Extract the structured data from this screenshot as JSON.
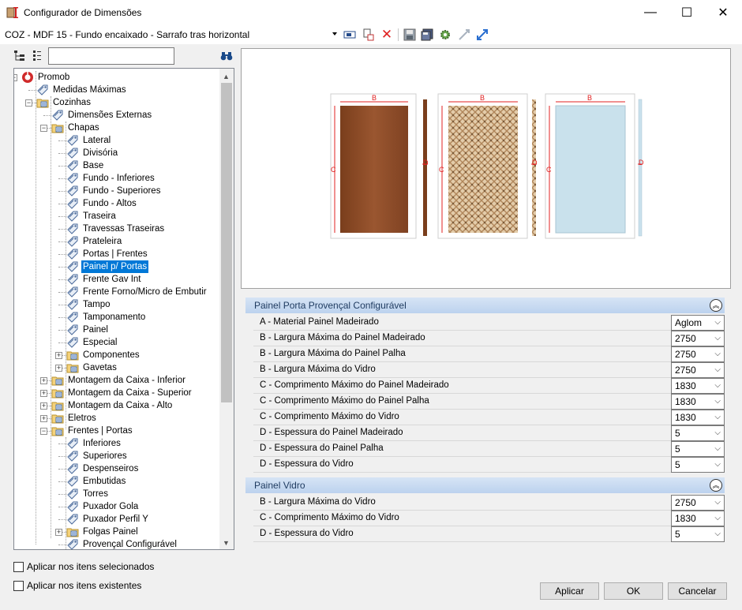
{
  "window": {
    "title": "Configurador de Dimensões",
    "minimize": "—",
    "maximize": "☐",
    "close": "✕"
  },
  "toolbar": {
    "combo_value": "COZ - MDF 15 - Fundo encaixado - Sarrafo tras horizontal"
  },
  "tree": {
    "search_value": "",
    "items": [
      {
        "label": "Promob",
        "level": 0,
        "expander": "minus",
        "icon": "promob-logo-icon"
      },
      {
        "label": "Medidas Máximas",
        "level": 1,
        "icon": "tag-icon"
      },
      {
        "label": "Cozinhas",
        "level": 1,
        "expander": "minus",
        "icon": "folder-icon"
      },
      {
        "label": "Dimensões Externas",
        "level": 2,
        "icon": "tag-icon"
      },
      {
        "label": "Chapas",
        "level": 2,
        "expander": "minus",
        "icon": "folder-icon"
      },
      {
        "label": "Lateral",
        "level": 3,
        "icon": "tag-icon"
      },
      {
        "label": "Divisória",
        "level": 3,
        "icon": "tag-icon"
      },
      {
        "label": "Base",
        "level": 3,
        "icon": "tag-icon"
      },
      {
        "label": "Fundo - Inferiores",
        "level": 3,
        "icon": "tag-icon"
      },
      {
        "label": "Fundo - Superiores",
        "level": 3,
        "icon": "tag-icon"
      },
      {
        "label": "Fundo - Altos",
        "level": 3,
        "icon": "tag-icon"
      },
      {
        "label": "Traseira",
        "level": 3,
        "icon": "tag-icon"
      },
      {
        "label": "Travessas Traseiras",
        "level": 3,
        "icon": "tag-icon"
      },
      {
        "label": "Prateleira",
        "level": 3,
        "icon": "tag-icon"
      },
      {
        "label": "Portas | Frentes",
        "level": 3,
        "icon": "tag-icon"
      },
      {
        "label": "Painel p/ Portas",
        "level": 3,
        "icon": "tag-icon",
        "selected": true
      },
      {
        "label": "Frente Gav Int",
        "level": 3,
        "icon": "tag-icon"
      },
      {
        "label": "Frente Forno/Micro de Embutir",
        "level": 3,
        "icon": "tag-icon"
      },
      {
        "label": "Tampo",
        "level": 3,
        "icon": "tag-icon"
      },
      {
        "label": "Tamponamento",
        "level": 3,
        "icon": "tag-icon"
      },
      {
        "label": "Painel",
        "level": 3,
        "icon": "tag-icon"
      },
      {
        "label": "Especial",
        "level": 3,
        "icon": "tag-icon"
      },
      {
        "label": "Componentes",
        "level": 3,
        "expander": "plus",
        "icon": "folder-icon"
      },
      {
        "label": "Gavetas",
        "level": 3,
        "expander": "plus",
        "icon": "folder-icon"
      },
      {
        "label": "Montagem da Caixa - Inferior",
        "level": 2,
        "expander": "plus",
        "icon": "folder-icon"
      },
      {
        "label": "Montagem da Caixa - Superior",
        "level": 2,
        "expander": "plus",
        "icon": "folder-icon"
      },
      {
        "label": "Montagem da Caixa - Alto",
        "level": 2,
        "expander": "plus",
        "icon": "folder-icon"
      },
      {
        "label": "Eletros",
        "level": 2,
        "expander": "plus",
        "icon": "folder-icon"
      },
      {
        "label": "Frentes | Portas",
        "level": 2,
        "expander": "minus",
        "icon": "folder-icon"
      },
      {
        "label": "Inferiores",
        "level": 3,
        "icon": "tag-icon"
      },
      {
        "label": "Superiores",
        "level": 3,
        "icon": "tag-icon"
      },
      {
        "label": "Despenseiros",
        "level": 3,
        "icon": "tag-icon"
      },
      {
        "label": "Embutidas",
        "level": 3,
        "icon": "tag-icon"
      },
      {
        "label": "Torres",
        "level": 3,
        "icon": "tag-icon"
      },
      {
        "label": "Puxador Gola",
        "level": 3,
        "icon": "tag-icon"
      },
      {
        "label": "Puxador Perfil Y",
        "level": 3,
        "icon": "tag-icon"
      },
      {
        "label": "Folgas Painel",
        "level": 3,
        "expander": "plus",
        "icon": "folder-icon"
      },
      {
        "label": "Provençal Configurável",
        "level": 3,
        "icon": "tag-icon"
      }
    ]
  },
  "preview": {
    "dim_b": "B",
    "dim_c": "C",
    "dim_d": "D"
  },
  "sections": [
    {
      "title": "Painel Porta Provençal Configurável",
      "rows": [
        {
          "label": "A - Material Painel Madeirado",
          "value": "Aglom"
        },
        {
          "label": "B - Largura Máxima do Painel Madeirado",
          "value": "2750"
        },
        {
          "label": "B - Largura Máxima do Painel Palha",
          "value": "2750"
        },
        {
          "label": "B - Largura Máxima do Vidro",
          "value": "2750"
        },
        {
          "label": "C - Comprimento Máximo do Painel Madeirado",
          "value": "1830"
        },
        {
          "label": "C - Comprimento Máximo do Painel Palha",
          "value": "1830"
        },
        {
          "label": "C - Comprimento Máximo do Vidro",
          "value": "1830"
        },
        {
          "label": "D - Espessura do Painel Madeirado",
          "value": "5"
        },
        {
          "label": "D - Espessura do Painel Palha",
          "value": "5"
        },
        {
          "label": "D - Espessura do Vidro",
          "value": "5"
        }
      ]
    },
    {
      "title": "Painel Vidro",
      "rows": [
        {
          "label": "B - Largura Máxima do Vidro",
          "value": "2750"
        },
        {
          "label": "C - Comprimento Máximo do Vidro",
          "value": "1830"
        },
        {
          "label": "D - Espessura do Vidro",
          "value": "5"
        }
      ]
    }
  ],
  "options": {
    "apply_selected": "Aplicar nos itens selecionados",
    "apply_existing": "Aplicar nos itens existentes"
  },
  "buttons": {
    "apply": "Aplicar",
    "ok": "OK",
    "cancel": "Cancelar"
  },
  "colors": {
    "accent": "#0078d7",
    "section_header": "#c6d9f1",
    "wood": "#8a4a26",
    "glass": "#c9e1ec",
    "dim_red": "#e02020"
  }
}
